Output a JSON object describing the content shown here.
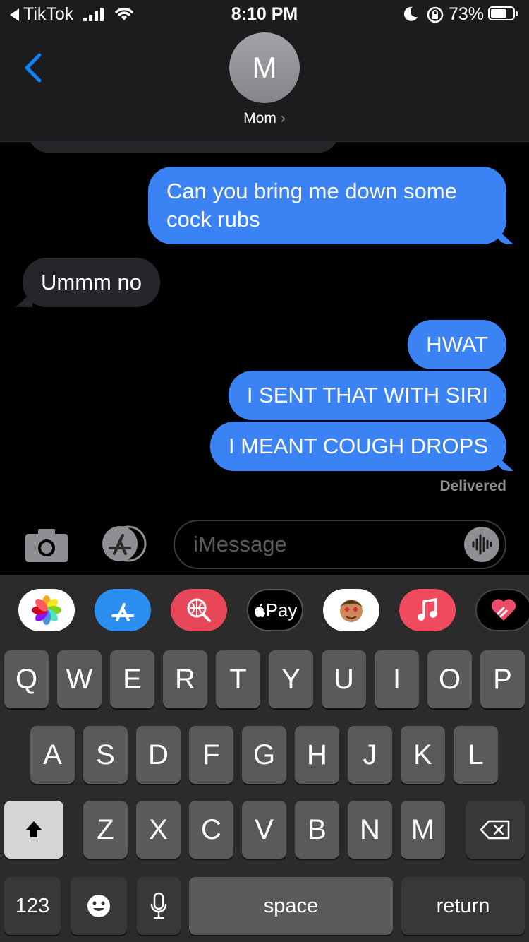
{
  "status_bar": {
    "back_app": "TikTok",
    "time": "8:10 PM",
    "battery_percent": "73%",
    "battery_level": 0.73
  },
  "header": {
    "avatar_letter": "M",
    "contact_name": "Mom",
    "chevron": "›"
  },
  "messages": [
    {
      "side": "outgoing",
      "lines": [
        "Can you bring me down some",
        "cock rubs"
      ]
    },
    {
      "side": "incoming",
      "lines": [
        "Ummm no"
      ]
    },
    {
      "side": "outgoing",
      "lines": [
        "HWAT"
      ]
    },
    {
      "side": "outgoing",
      "lines": [
        "I SENT THAT WITH SIRI"
      ]
    },
    {
      "side": "outgoing",
      "lines": [
        "I MEANT COUGH DROPS"
      ]
    }
  ],
  "delivered": "Delivered",
  "input": {
    "placeholder": "iMessage"
  },
  "app_drawer": [
    {
      "name": "photos-app-icon"
    },
    {
      "name": "app-store-icon"
    },
    {
      "name": "web-search-icon"
    },
    {
      "name": "apple-pay-icon",
      "label": "Pay"
    },
    {
      "name": "memoji-icon"
    },
    {
      "name": "music-icon"
    },
    {
      "name": "digital-touch-icon"
    }
  ],
  "keyboard": {
    "row1": [
      "Q",
      "W",
      "E",
      "R",
      "T",
      "Y",
      "U",
      "I",
      "O",
      "P"
    ],
    "row2": [
      "A",
      "S",
      "D",
      "F",
      "G",
      "H",
      "J",
      "K",
      "L"
    ],
    "row3": [
      "Z",
      "X",
      "C",
      "V",
      "B",
      "N",
      "M"
    ],
    "numbers": "123",
    "space": "space",
    "return": "return"
  },
  "colors": {
    "outgoing_bubble": "#3b82f5",
    "incoming_bubble": "#26262a",
    "accent": "#0a84ff"
  }
}
